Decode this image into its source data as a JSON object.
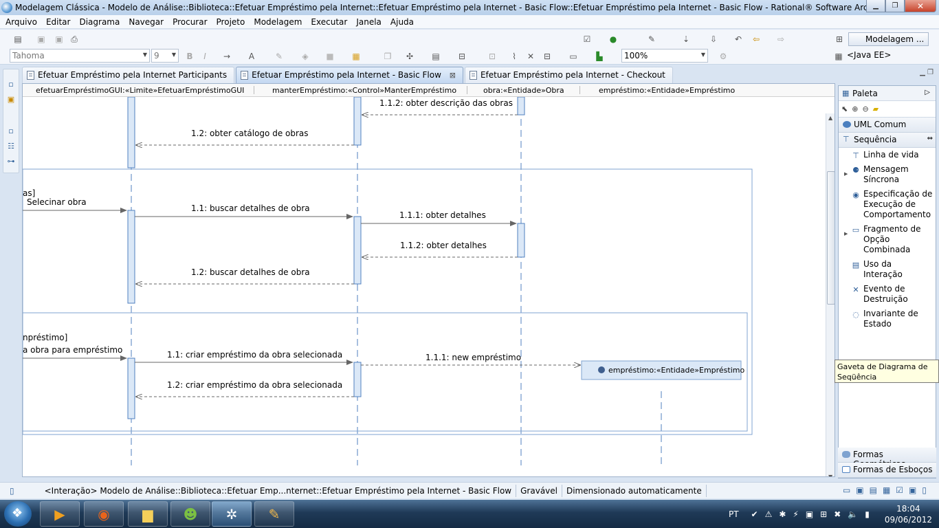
{
  "window": {
    "title": "Modelagem Clássica - Modelo de Análise::Biblioteca::Efetuar Empréstimo pela Internet::Efetuar Empréstimo pela Internet - Basic Flow::Efetuar Empréstimo pela Internet - Basic Flow - Rational® Software Architect"
  },
  "menu": [
    "Arquivo",
    "Editar",
    "Diagrama",
    "Navegar",
    "Procurar",
    "Projeto",
    "Modelagem",
    "Executar",
    "Janela",
    "Ajuda"
  ],
  "toolbar": {
    "font_name": "Tahoma",
    "font_size": "9",
    "zoom": "100%",
    "perspective_modelagem": "Modelagem ...",
    "perspective_javaee": "<Java EE>"
  },
  "tabs": [
    {
      "label": "Efetuar Empréstimo pela Internet Participants",
      "active": false
    },
    {
      "label": "Efetuar Empréstimo pela Internet - Basic Flow",
      "active": true
    },
    {
      "label": "Efetuar Empréstimo pela Internet - Checkout",
      "active": false
    }
  ],
  "lifelines": [
    "efetuarEmpréstimoGUI:«Limite»EfetuarEmpréstimoGUI",
    "manterEmpréstimo:«Control»ManterEmpréstimo",
    "obra:«Entidade»Obra",
    "empréstimo:«Entidade»Empréstimo"
  ],
  "messages": {
    "m_obter_descricao": "1.1.2: obter descrição das obras",
    "m_obter_catalogo": "1.2: obter catálogo de obras",
    "frag1_guard": "as]",
    "m_selecionar": "Selecinar obra",
    "m_buscar_detalhes": "1.1: buscar detalhes de obra",
    "m_obter_detalhes": "1.1.1: obter detalhes",
    "m_obter_detalhes_ret": "1.1.2: obter detalhes",
    "m_buscar_detalhes_ret": "1.2: buscar detalhes de obra",
    "frag2_guard": "npréstimo]",
    "m_selecionar_obra_emprestimo": "a obra para empréstimo",
    "m_criar": "1.1: criar empréstimo da obra selecionada",
    "m_new": "1.1.1: new empréstimo",
    "m_criar_ret": "1.2: criar empréstimo da obra selecionada",
    "created_object": "empréstimo:«Entidade»Empréstimo"
  },
  "palette": {
    "title": "Paleta",
    "drawer_uml": "UML Comum",
    "drawer_sequencia": "Sequência",
    "items": [
      "Linha de vida",
      "Mensagem Síncrona",
      "Especificação de Execução de Comportamento",
      "Fragmento de Opção Combinada",
      "Uso da Interação",
      "Evento de Destruição",
      "Invariante de Estado"
    ],
    "drawer_geom": "Formas Geométricas",
    "drawer_esbocos": "Formas de Esboços",
    "tooltip": "Gaveta de Diagrama de Seqüência"
  },
  "status": {
    "context": "<Interação> Modelo de Análise::Biblioteca::Efetuar Emp...nternet::Efetuar Empréstimo pela Internet - Basic Flow",
    "writable": "Gravável",
    "sizing": "Dimensionado automaticamente"
  },
  "taskbar": {
    "language": "PT",
    "time": "18:04",
    "date": "09/06/2012"
  },
  "colors": {
    "lifeline": "#4f7fbf",
    "activation_fill": "#dbe8f7",
    "fragment_border": "#7fa3d0"
  }
}
